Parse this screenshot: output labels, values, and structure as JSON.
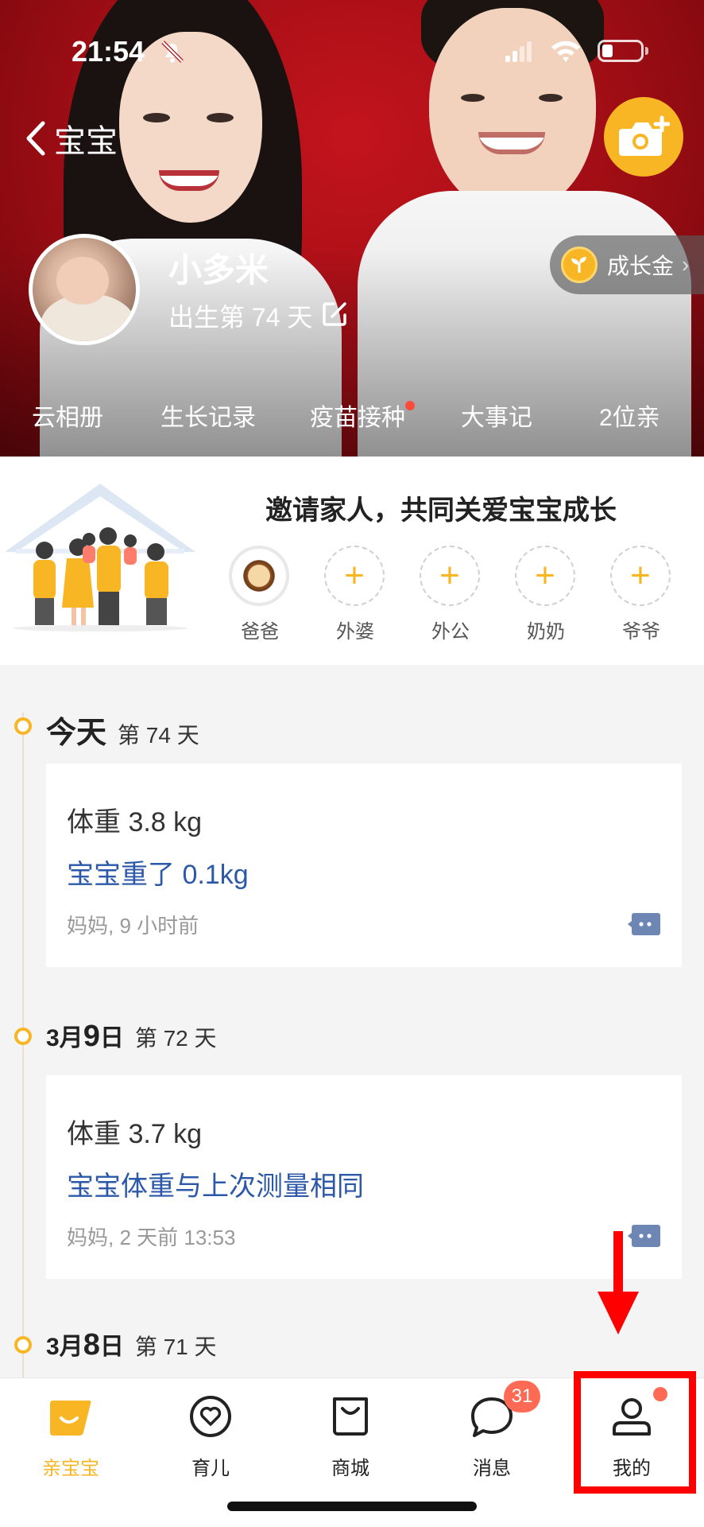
{
  "status_bar": {
    "time": "21:54"
  },
  "header": {
    "back_label": "宝宝",
    "baby_name": "小多米",
    "baby_age": "出生第 74 天",
    "growth_gold_label": "成长金",
    "tabs": [
      {
        "label": "云相册",
        "has_dot": false
      },
      {
        "label": "生长记录",
        "has_dot": false
      },
      {
        "label": "疫苗接种",
        "has_dot": true
      },
      {
        "label": "大事记",
        "has_dot": false
      },
      {
        "label": "2位亲",
        "has_dot": false
      }
    ]
  },
  "invite": {
    "title": "邀请家人，共同关爱宝宝成长",
    "members": [
      {
        "label": "爸爸",
        "filled": true
      },
      {
        "label": "外婆",
        "filled": false
      },
      {
        "label": "外公",
        "filled": false
      },
      {
        "label": "奶奶",
        "filled": false
      },
      {
        "label": "爷爷",
        "filled": false
      }
    ],
    "add_symbol": "+"
  },
  "timeline": [
    {
      "date": "今天",
      "day": "第 74 天",
      "weight": "体重 3.8 kg",
      "message": "宝宝重了 0.1kg",
      "meta": "妈妈, 9 小时前"
    },
    {
      "date_month": "3月",
      "date_day": "9",
      "date_suffix": "日",
      "day": "第 72 天",
      "weight": "体重 3.7 kg",
      "message": "宝宝体重与上次测量相同",
      "meta": "妈妈, 2 天前 13:53"
    },
    {
      "date_month": "3月",
      "date_day": "8",
      "date_suffix": "日",
      "day": "第 71 天"
    }
  ],
  "bottom_nav": {
    "items": [
      {
        "label": "亲宝宝",
        "icon": "home-icon",
        "active": true
      },
      {
        "label": "育儿",
        "icon": "heart-icon",
        "active": false
      },
      {
        "label": "商城",
        "icon": "shopping-bag-icon",
        "active": false
      },
      {
        "label": "消息",
        "icon": "chat-bubble-icon",
        "active": false
      },
      {
        "label": "我的",
        "icon": "person-icon",
        "active": false
      }
    ],
    "message_badge": "31"
  },
  "colors": {
    "accent": "#f8b625",
    "link_blue": "#2c58a8",
    "badge_red": "#ff6a55",
    "annotation_red": "#ff0000"
  }
}
